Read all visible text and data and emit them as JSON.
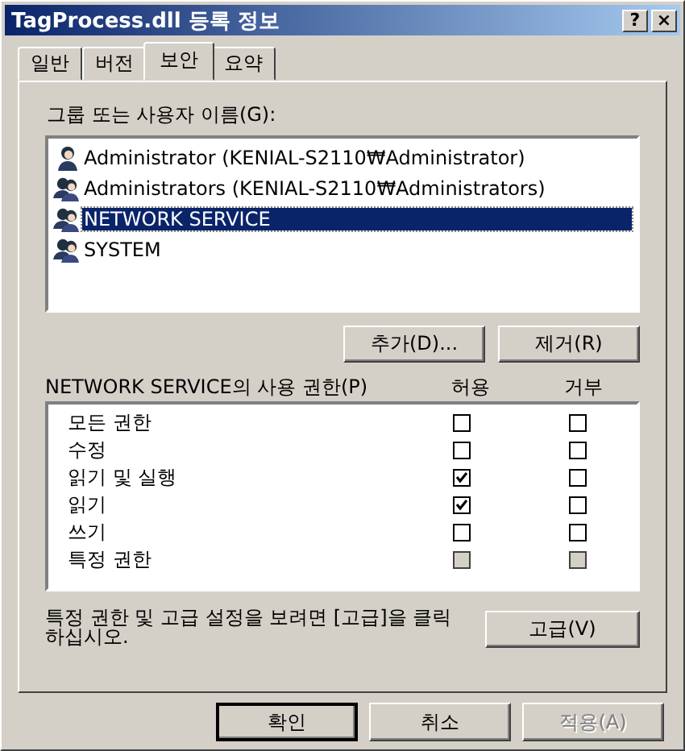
{
  "window": {
    "title": "TagProcess.dll 등록 정보",
    "help_button": "?",
    "close_button": "×"
  },
  "tabs": [
    {
      "label": "일반",
      "selected": false
    },
    {
      "label": "버전",
      "selected": false
    },
    {
      "label": "보안",
      "selected": true
    },
    {
      "label": "요약",
      "selected": false
    }
  ],
  "users": {
    "label": "그룹 또는 사용자 이름(G):",
    "items": [
      {
        "name": "Administrator (KENIAL-S2110₩Administrator)",
        "kind": "user",
        "selected": false
      },
      {
        "name": "Administrators (KENIAL-S2110₩Administrators)",
        "kind": "group",
        "selected": false
      },
      {
        "name": "NETWORK SERVICE",
        "kind": "group",
        "selected": true
      },
      {
        "name": "SYSTEM",
        "kind": "group",
        "selected": false
      }
    ],
    "buttons": [
      "추가(D)...",
      "제거(R)"
    ]
  },
  "permissions": {
    "label": "NETWORK SERVICE의 사용 권한(P)",
    "allow_header": "허용",
    "deny_header": "거부",
    "rows": [
      {
        "name": "모든 권한",
        "allow": false,
        "deny": false,
        "disabled": false
      },
      {
        "name": "수정",
        "allow": false,
        "deny": false,
        "disabled": false
      },
      {
        "name": "읽기 및 실행",
        "allow": true,
        "deny": false,
        "disabled": false
      },
      {
        "name": "읽기",
        "allow": true,
        "deny": false,
        "disabled": false
      },
      {
        "name": "쓰기",
        "allow": false,
        "deny": false,
        "disabled": false
      },
      {
        "name": "특정 권한",
        "allow": false,
        "deny": false,
        "disabled": true
      }
    ]
  },
  "advanced": {
    "text": "특정 권한 및 고급 설정을 보려면 [고급]을 클릭하십시오.",
    "button": "고급(V)"
  },
  "footer_buttons": [
    {
      "label": "확인",
      "default": true,
      "disabled": false
    },
    {
      "label": "취소",
      "default": false,
      "disabled": false
    },
    {
      "label": "적용(A)",
      "default": false,
      "disabled": true
    }
  ]
}
